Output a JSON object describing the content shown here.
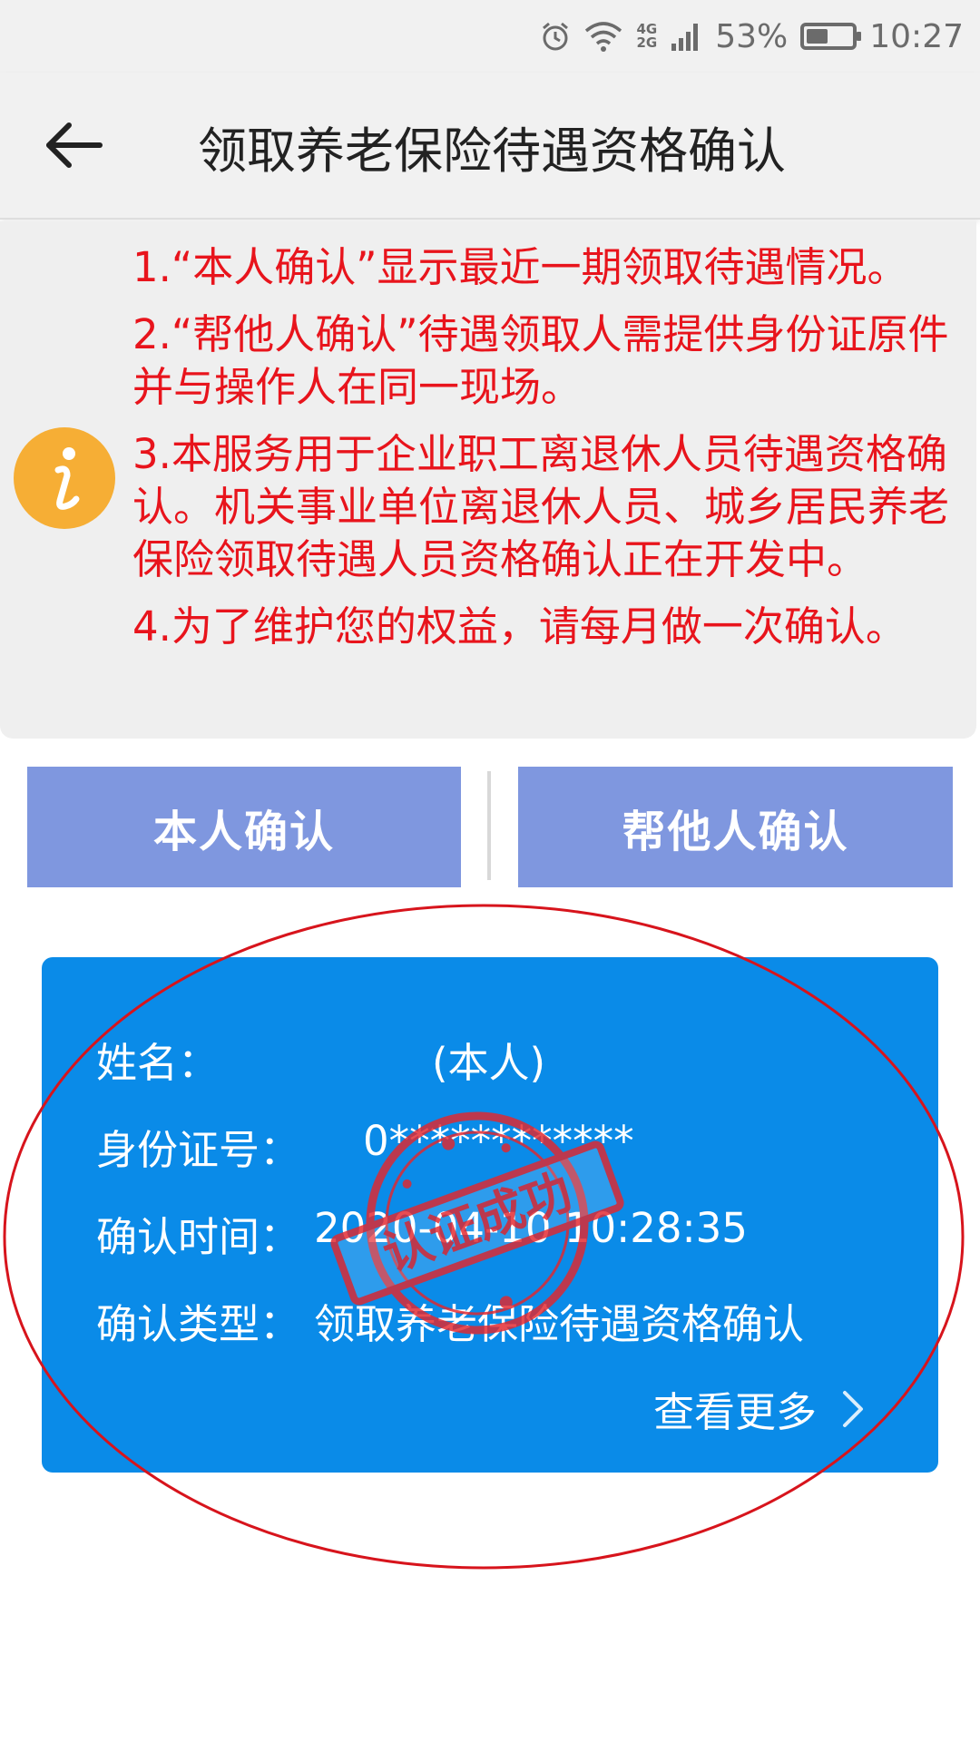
{
  "status_bar": {
    "network_top": "4G",
    "network_bottom": "2G",
    "battery_text": "53%",
    "battery_level": 0.53,
    "time": "10:27"
  },
  "header": {
    "title": "领取养老保险待遇资格确认"
  },
  "notice": {
    "items": [
      "1.“本人确认”显示最近一期领取待遇情况。",
      "2.“帮他人确认”待遇领取人需提供身份证原件并与操作人在同一现场。",
      "3.本服务用于企业职工离退休人员待遇资格确认。机关事业单位离退休人员、城乡居民养老保险领取待遇人员资格确认正在开发中。",
      "4.为了维护您的权益，请每月做一次确认。"
    ]
  },
  "buttons": {
    "self_confirm": "本人确认",
    "help_confirm": "帮他人确认"
  },
  "result": {
    "name_label": "姓名：",
    "name_value": "(本人)",
    "id_label": "身份证号：",
    "id_value": "0************",
    "time_label": "确认时间：",
    "time_value": "2020-04-10 10:28:35",
    "type_label": "确认类型：",
    "type_value": "领取养老保险待遇资格确认",
    "view_more": "查看更多",
    "stamp_text": "认证成功"
  },
  "colors": {
    "notice_text": "#e8141c",
    "button_bg": "#7f97df",
    "card_bg": "#0a8be8",
    "info_icon": "#f6ae35",
    "stamp": "#e3262d"
  },
  "icons": {
    "back": "arrow-left-icon",
    "info": "info-icon",
    "more": "chevron-right-icon"
  }
}
